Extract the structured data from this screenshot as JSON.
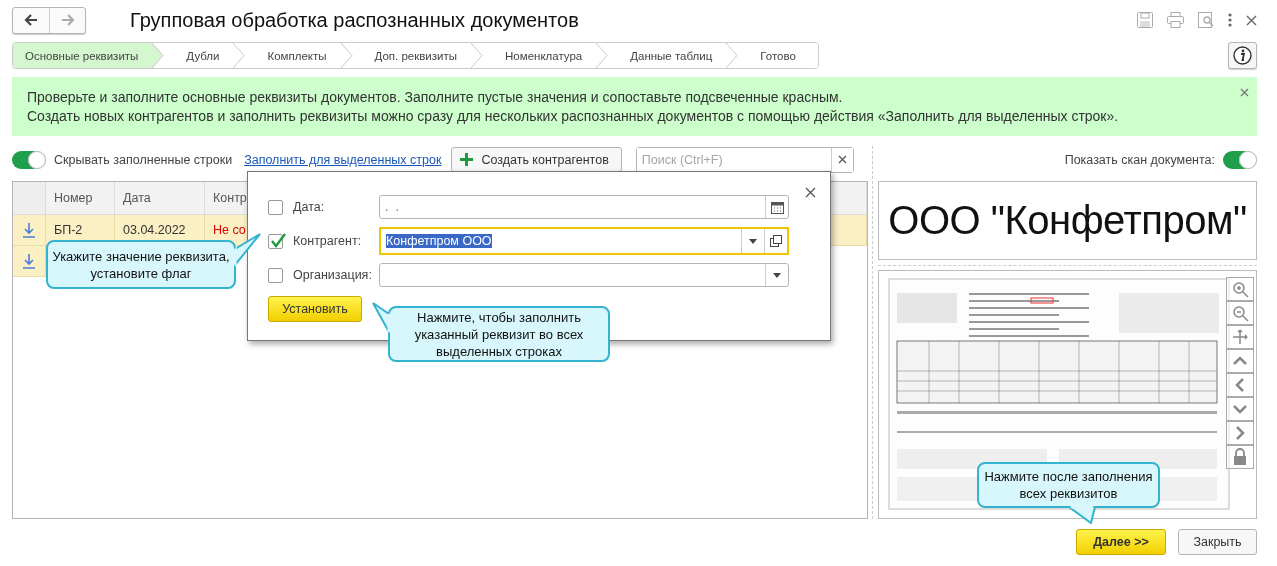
{
  "window": {
    "title": "Групповая обработка распознанных документов"
  },
  "nav_buttons": [
    {
      "kind": "back",
      "disabled": false
    },
    {
      "kind": "forward",
      "disabled": true
    }
  ],
  "steps": [
    {
      "label": "Основные реквизиты",
      "selected": true
    },
    {
      "label": "Дубли",
      "selected": false
    },
    {
      "label": "Комплекты",
      "selected": false
    },
    {
      "label": "Доп. реквизиты",
      "selected": false
    },
    {
      "label": "Номенклатура",
      "selected": false
    },
    {
      "label": "Данные таблиц",
      "selected": false
    },
    {
      "label": "Готово",
      "selected": false
    }
  ],
  "banner": {
    "lines": [
      "Проверьте и заполните основные реквизиты документов. Заполните пустые значения и сопоставьте подсвеченные красным.",
      "Создать новых контрагентов и заполнить реквизиты можно сразу для нескольких распознанных документов с помощью действия «Заполнить для выделенных строк»."
    ]
  },
  "hide_filled_toggle": {
    "label": "Скрывать заполненные строки",
    "on": true
  },
  "fill_link": "Заполнить для выделенных строк",
  "create_button": "Создать контрагентов",
  "search": {
    "placeholder": "Поиск (Ctrl+F)"
  },
  "table": {
    "columns": [
      "Номер",
      "Дата",
      "Контр"
    ],
    "rows": [
      {
        "selected": true,
        "error": true,
        "cells": [
          "БП-2",
          "03.04.2022",
          "Не со"
        ]
      },
      {
        "selected": true
      }
    ]
  },
  "scan_toggle": {
    "label": "Показать скан документа:",
    "on": true
  },
  "scan_fragment": {
    "text": "ООО \"Конфетпром\""
  },
  "dialog": {
    "fields": [
      {
        "kind": "date",
        "label": "Дата:",
        "checked": false,
        "focused": false,
        "value": ".  ."
      },
      {
        "kind": "choice_open",
        "label": "Контрагент:",
        "checked": true,
        "focused": true,
        "value": "Конфетпром ООО"
      },
      {
        "kind": "choice",
        "label": "Организация:",
        "checked": false,
        "focused": false
      }
    ],
    "button": "Установить"
  },
  "callouts": [
    {
      "text": "Укажите значение реквизита, установите флаг"
    },
    {
      "text": "Нажмите, чтобы заполнить указанный реквизит во всех выделенных строках"
    },
    {
      "text": "Нажмите после заполнения всех реквизитов"
    }
  ],
  "footer_buttons": [
    {
      "kind": "primary",
      "label": "Далее >>"
    },
    {
      "kind": "default",
      "label": "Закрыть"
    }
  ]
}
